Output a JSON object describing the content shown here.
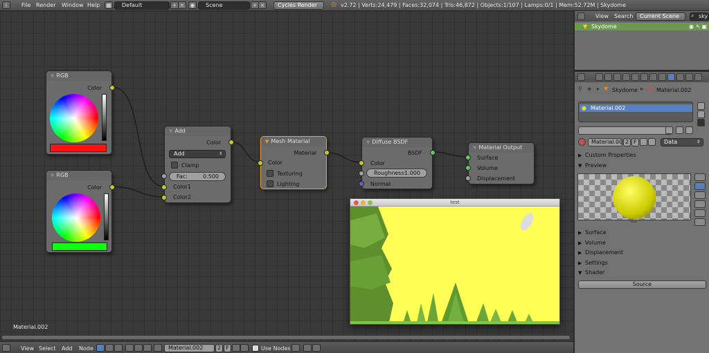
{
  "topbar": {
    "menus": [
      "File",
      "Render",
      "Window",
      "Help"
    ],
    "layout_field": "Default",
    "scene_field": "Scene",
    "render_engine": "Cycles Render",
    "stats": "v2.72 | Verts:24,479 | Faces:32,074 | Tris:46,872 | Objects:1/107 | Lamps:0/1 | Mem:52.72M | Skydome"
  },
  "nodes": {
    "rgb1": {
      "title": "RGB",
      "out_color": "Color",
      "swatch": "#ff1111"
    },
    "rgb2": {
      "title": "RGB",
      "out_color": "Color",
      "swatch": "#11ff11"
    },
    "add": {
      "title": "Add",
      "out_color": "Color",
      "blend_mode": "Add",
      "clamp": "Clamp",
      "fac_label": "Fac:",
      "fac_value": "0.500",
      "in_color1": "Color1",
      "in_color2": "Color2"
    },
    "mesh_material": {
      "title": "Mesh Material",
      "out_material": "Material",
      "in_color": "Color",
      "texturing": "Texturing",
      "lighting": "Lighting"
    },
    "diffuse": {
      "title": "Diffuse BSDF",
      "out_bsdf": "BSDF",
      "in_color": "Color",
      "roughness_label": "Roughness:",
      "roughness_value": "1.000",
      "in_normal": "Normal"
    },
    "output": {
      "title": "Material Output",
      "in_surface": "Surface",
      "in_volume": "Volume",
      "in_displacement": "Displacement"
    }
  },
  "canvas_material_label": "Material.002",
  "preview_window": {
    "title": "test"
  },
  "bottombar": {
    "menus": [
      "View",
      "Select",
      "Add",
      "Node"
    ],
    "material_field": "Material.002",
    "users_count": "2",
    "fake_user": "F",
    "use_nodes": "Use Nodes"
  },
  "outliner": {
    "menus": [
      "View",
      "Search"
    ],
    "scene_dropdown": "Current Scene",
    "search_placeholder": "sky",
    "rows": [
      {
        "label": "Skydome"
      }
    ]
  },
  "properties": {
    "breadcrumb_object": "Skydome",
    "breadcrumb_material": "Material.002",
    "material_slot": "Material.002",
    "material_field": "Material.002",
    "users_count": "2",
    "fake_user": "F",
    "data_dropdown": "Data",
    "sections": [
      "Custom Properties",
      "Preview",
      "Surface",
      "Volume",
      "Displacement",
      "Settings",
      "Shader"
    ],
    "source_button": "Source"
  },
  "colors": {
    "accent_selected": "#e8a040",
    "socket_color": "#c7c729",
    "socket_shader": "#63c763",
    "socket_value": "#a1a1a1",
    "socket_vector": "#6363c7",
    "sky": "#ffff55",
    "tree": "#6aa53a"
  }
}
